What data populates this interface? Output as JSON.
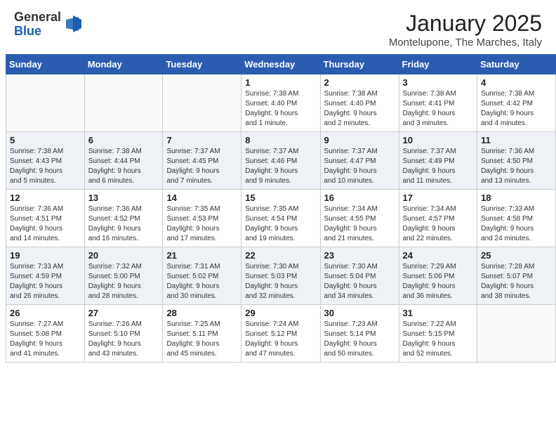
{
  "header": {
    "logo_general": "General",
    "logo_blue": "Blue",
    "month_title": "January 2025",
    "location": "Montelupone, The Marches, Italy"
  },
  "weekdays": [
    "Sunday",
    "Monday",
    "Tuesday",
    "Wednesday",
    "Thursday",
    "Friday",
    "Saturday"
  ],
  "weeks": [
    [
      {
        "day": "",
        "info": ""
      },
      {
        "day": "",
        "info": ""
      },
      {
        "day": "",
        "info": ""
      },
      {
        "day": "1",
        "info": "Sunrise: 7:38 AM\nSunset: 4:40 PM\nDaylight: 9 hours\nand 1 minute."
      },
      {
        "day": "2",
        "info": "Sunrise: 7:38 AM\nSunset: 4:40 PM\nDaylight: 9 hours\nand 2 minutes."
      },
      {
        "day": "3",
        "info": "Sunrise: 7:38 AM\nSunset: 4:41 PM\nDaylight: 9 hours\nand 3 minutes."
      },
      {
        "day": "4",
        "info": "Sunrise: 7:38 AM\nSunset: 4:42 PM\nDaylight: 9 hours\nand 4 minutes."
      }
    ],
    [
      {
        "day": "5",
        "info": "Sunrise: 7:38 AM\nSunset: 4:43 PM\nDaylight: 9 hours\nand 5 minutes."
      },
      {
        "day": "6",
        "info": "Sunrise: 7:38 AM\nSunset: 4:44 PM\nDaylight: 9 hours\nand 6 minutes."
      },
      {
        "day": "7",
        "info": "Sunrise: 7:37 AM\nSunset: 4:45 PM\nDaylight: 9 hours\nand 7 minutes."
      },
      {
        "day": "8",
        "info": "Sunrise: 7:37 AM\nSunset: 4:46 PM\nDaylight: 9 hours\nand 9 minutes."
      },
      {
        "day": "9",
        "info": "Sunrise: 7:37 AM\nSunset: 4:47 PM\nDaylight: 9 hours\nand 10 minutes."
      },
      {
        "day": "10",
        "info": "Sunrise: 7:37 AM\nSunset: 4:49 PM\nDaylight: 9 hours\nand 11 minutes."
      },
      {
        "day": "11",
        "info": "Sunrise: 7:36 AM\nSunset: 4:50 PM\nDaylight: 9 hours\nand 13 minutes."
      }
    ],
    [
      {
        "day": "12",
        "info": "Sunrise: 7:36 AM\nSunset: 4:51 PM\nDaylight: 9 hours\nand 14 minutes."
      },
      {
        "day": "13",
        "info": "Sunrise: 7:36 AM\nSunset: 4:52 PM\nDaylight: 9 hours\nand 16 minutes."
      },
      {
        "day": "14",
        "info": "Sunrise: 7:35 AM\nSunset: 4:53 PM\nDaylight: 9 hours\nand 17 minutes."
      },
      {
        "day": "15",
        "info": "Sunrise: 7:35 AM\nSunset: 4:54 PM\nDaylight: 9 hours\nand 19 minutes."
      },
      {
        "day": "16",
        "info": "Sunrise: 7:34 AM\nSunset: 4:55 PM\nDaylight: 9 hours\nand 21 minutes."
      },
      {
        "day": "17",
        "info": "Sunrise: 7:34 AM\nSunset: 4:57 PM\nDaylight: 9 hours\nand 22 minutes."
      },
      {
        "day": "18",
        "info": "Sunrise: 7:33 AM\nSunset: 4:58 PM\nDaylight: 9 hours\nand 24 minutes."
      }
    ],
    [
      {
        "day": "19",
        "info": "Sunrise: 7:33 AM\nSunset: 4:59 PM\nDaylight: 9 hours\nand 26 minutes."
      },
      {
        "day": "20",
        "info": "Sunrise: 7:32 AM\nSunset: 5:00 PM\nDaylight: 9 hours\nand 28 minutes."
      },
      {
        "day": "21",
        "info": "Sunrise: 7:31 AM\nSunset: 5:02 PM\nDaylight: 9 hours\nand 30 minutes."
      },
      {
        "day": "22",
        "info": "Sunrise: 7:30 AM\nSunset: 5:03 PM\nDaylight: 9 hours\nand 32 minutes."
      },
      {
        "day": "23",
        "info": "Sunrise: 7:30 AM\nSunset: 5:04 PM\nDaylight: 9 hours\nand 34 minutes."
      },
      {
        "day": "24",
        "info": "Sunrise: 7:29 AM\nSunset: 5:06 PM\nDaylight: 9 hours\nand 36 minutes."
      },
      {
        "day": "25",
        "info": "Sunrise: 7:28 AM\nSunset: 5:07 PM\nDaylight: 9 hours\nand 38 minutes."
      }
    ],
    [
      {
        "day": "26",
        "info": "Sunrise: 7:27 AM\nSunset: 5:08 PM\nDaylight: 9 hours\nand 41 minutes."
      },
      {
        "day": "27",
        "info": "Sunrise: 7:26 AM\nSunset: 5:10 PM\nDaylight: 9 hours\nand 43 minutes."
      },
      {
        "day": "28",
        "info": "Sunrise: 7:25 AM\nSunset: 5:11 PM\nDaylight: 9 hours\nand 45 minutes."
      },
      {
        "day": "29",
        "info": "Sunrise: 7:24 AM\nSunset: 5:12 PM\nDaylight: 9 hours\nand 47 minutes."
      },
      {
        "day": "30",
        "info": "Sunrise: 7:23 AM\nSunset: 5:14 PM\nDaylight: 9 hours\nand 50 minutes."
      },
      {
        "day": "31",
        "info": "Sunrise: 7:22 AM\nSunset: 5:15 PM\nDaylight: 9 hours\nand 52 minutes."
      },
      {
        "day": "",
        "info": ""
      }
    ]
  ]
}
